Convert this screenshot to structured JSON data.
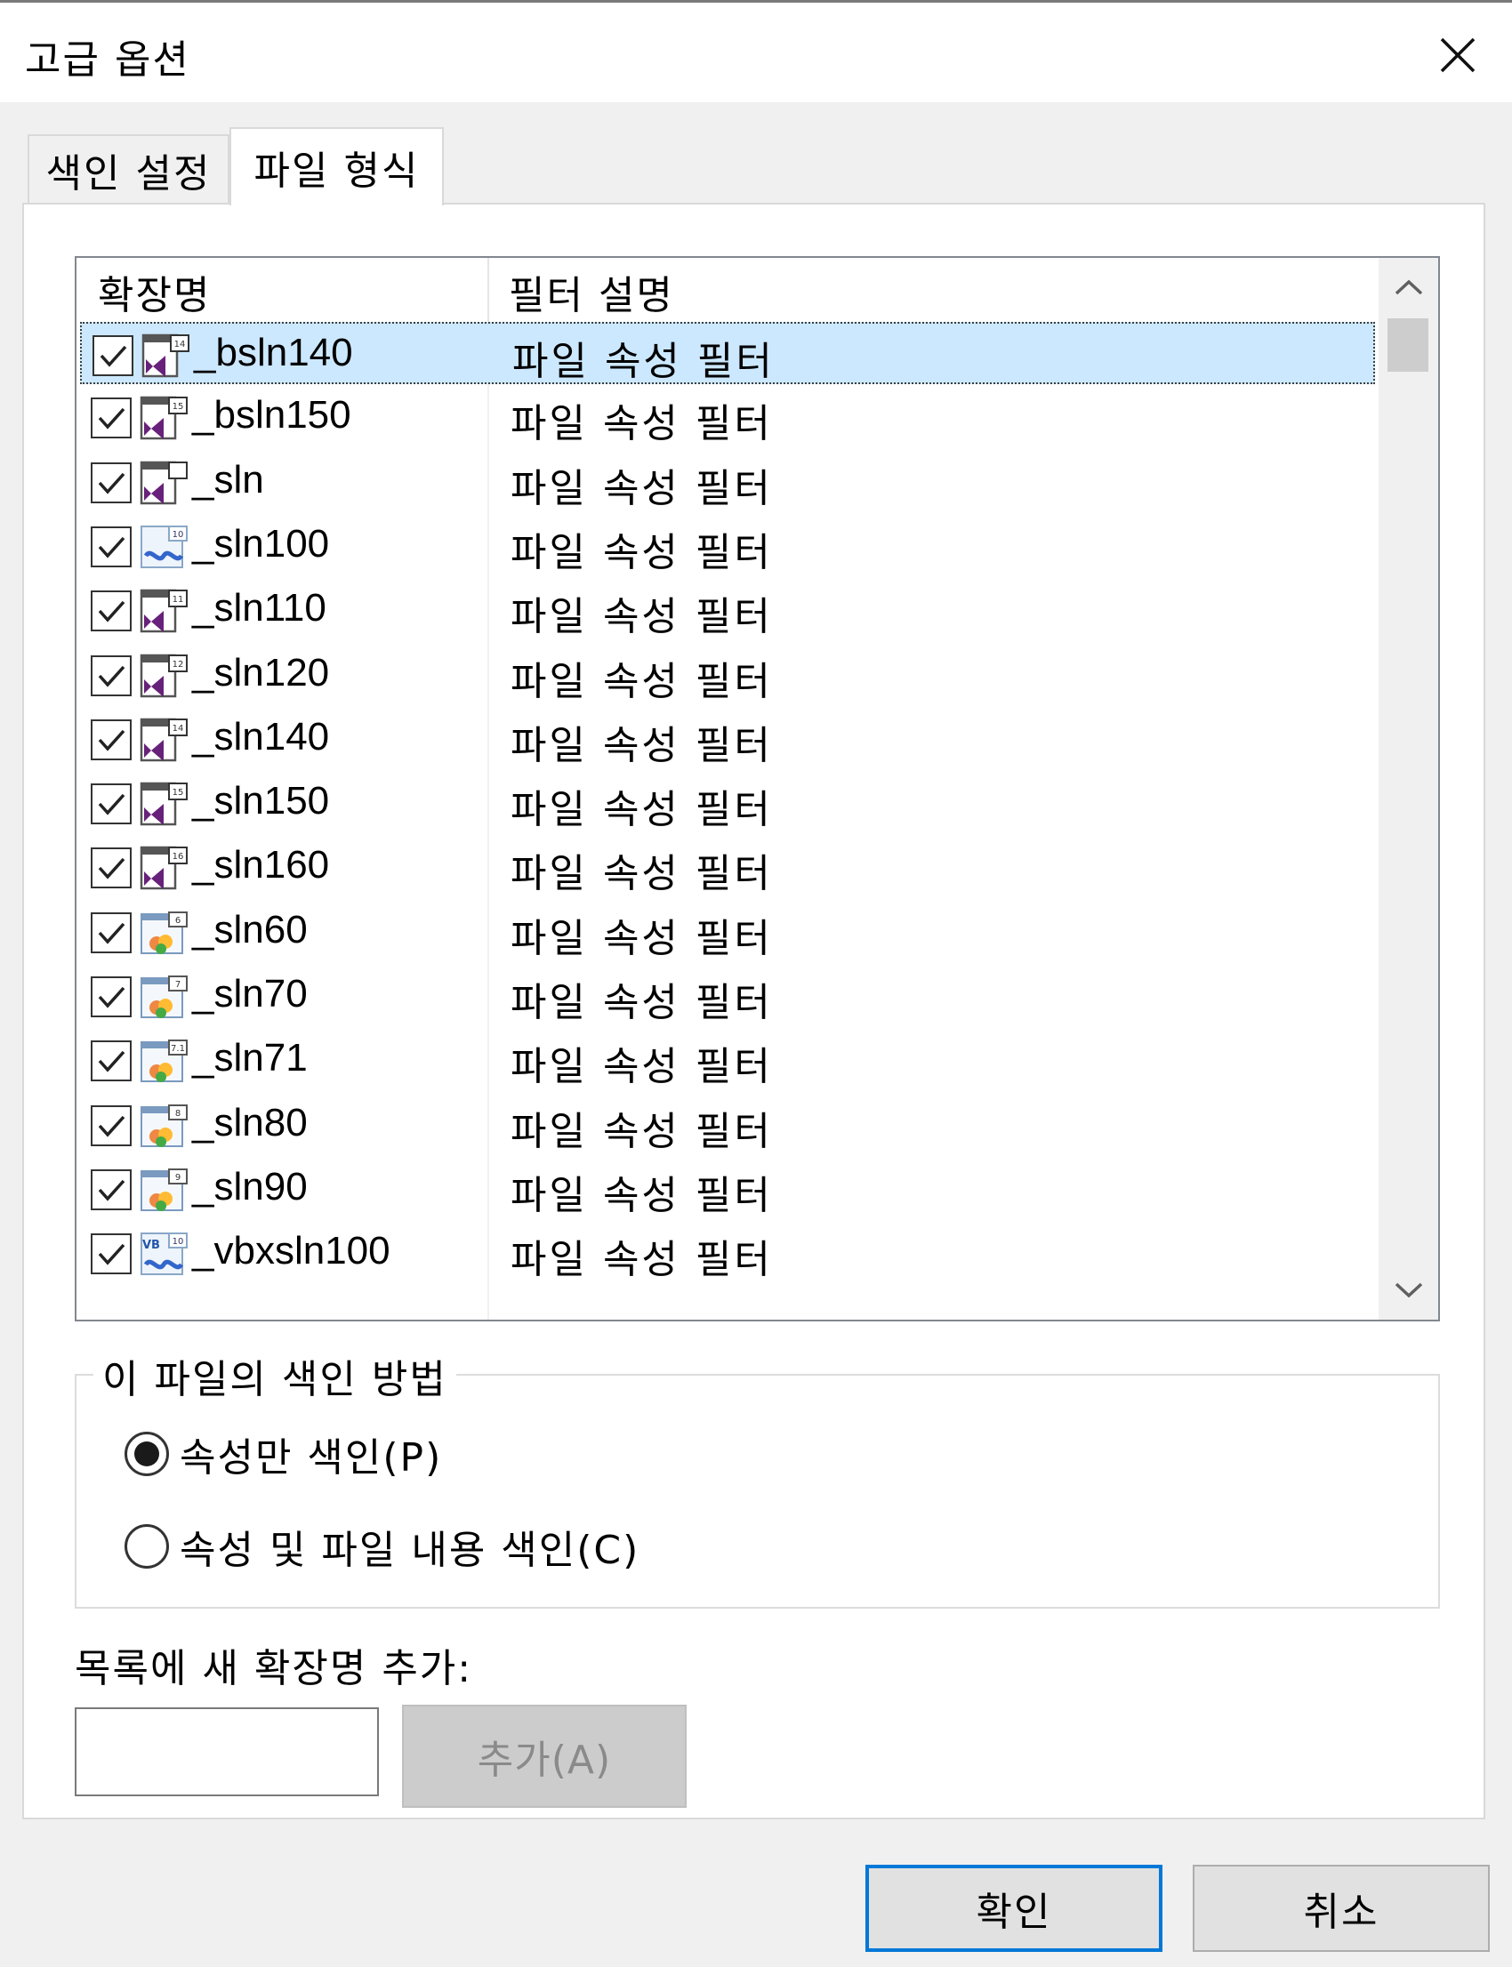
{
  "dialog": {
    "title": "고급 옵션",
    "close_icon": "close-icon"
  },
  "tabs": [
    {
      "label": "색인 설정",
      "active": false
    },
    {
      "label": "파일 형식",
      "active": true
    }
  ],
  "list": {
    "columns": [
      "확장명",
      "필터 설명"
    ],
    "rows": [
      {
        "ext": "_bsln140",
        "desc": "파일 속성 필터",
        "checked": true,
        "selected": true,
        "icon": "vs-solution-icon",
        "badge": "14"
      },
      {
        "ext": "_bsln150",
        "desc": "파일 속성 필터",
        "checked": true,
        "selected": false,
        "icon": "vs-solution-icon",
        "badge": "15"
      },
      {
        "ext": "_sln",
        "desc": "파일 속성 필터",
        "checked": true,
        "selected": false,
        "icon": "vs-solution-icon",
        "badge": ""
      },
      {
        "ext": "_sln100",
        "desc": "파일 속성 필터",
        "checked": true,
        "selected": false,
        "icon": "vs2010-solution-icon",
        "badge": "10"
      },
      {
        "ext": "_sln110",
        "desc": "파일 속성 필터",
        "checked": true,
        "selected": false,
        "icon": "vs-solution-icon",
        "badge": "11"
      },
      {
        "ext": "_sln120",
        "desc": "파일 속성 필터",
        "checked": true,
        "selected": false,
        "icon": "vs-solution-icon",
        "badge": "12"
      },
      {
        "ext": "_sln140",
        "desc": "파일 속성 필터",
        "checked": true,
        "selected": false,
        "icon": "vs-solution-icon",
        "badge": "14"
      },
      {
        "ext": "_sln150",
        "desc": "파일 속성 필터",
        "checked": true,
        "selected": false,
        "icon": "vs-solution-icon",
        "badge": "15"
      },
      {
        "ext": "_sln160",
        "desc": "파일 속성 필터",
        "checked": true,
        "selected": false,
        "icon": "vs-solution-icon",
        "badge": "16"
      },
      {
        "ext": "_sln60",
        "desc": "파일 속성 필터",
        "checked": true,
        "selected": false,
        "icon": "legacy-solution-icon",
        "badge": "6"
      },
      {
        "ext": "_sln70",
        "desc": "파일 속성 필터",
        "checked": true,
        "selected": false,
        "icon": "legacy-solution-icon",
        "badge": "7"
      },
      {
        "ext": "_sln71",
        "desc": "파일 속성 필터",
        "checked": true,
        "selected": false,
        "icon": "legacy-solution-icon",
        "badge": "7.1"
      },
      {
        "ext": "_sln80",
        "desc": "파일 속성 필터",
        "checked": true,
        "selected": false,
        "icon": "legacy-solution-icon",
        "badge": "8"
      },
      {
        "ext": "_sln90",
        "desc": "파일 속성 필터",
        "checked": true,
        "selected": false,
        "icon": "legacy-solution-icon",
        "badge": "9"
      },
      {
        "ext": "_vbxsln100",
        "desc": "파일 속성 필터",
        "checked": true,
        "selected": false,
        "icon": "vb-solution-icon",
        "badge": "10"
      }
    ]
  },
  "index_method": {
    "legend": "이 파일의 색인 방법",
    "options": [
      {
        "label": "속성만 색인(P)",
        "selected": true
      },
      {
        "label": "속성 및 파일 내용 색인(C)",
        "selected": false
      }
    ]
  },
  "add_extension": {
    "label": "목록에 새 확장명 추가:",
    "input_value": "",
    "button_label": "추가(A)"
  },
  "footer": {
    "ok_label": "확인",
    "cancel_label": "취소"
  },
  "colors": {
    "selection": "#cce8ff",
    "accent": "#0078d7",
    "vs_purple": "#68217a"
  }
}
